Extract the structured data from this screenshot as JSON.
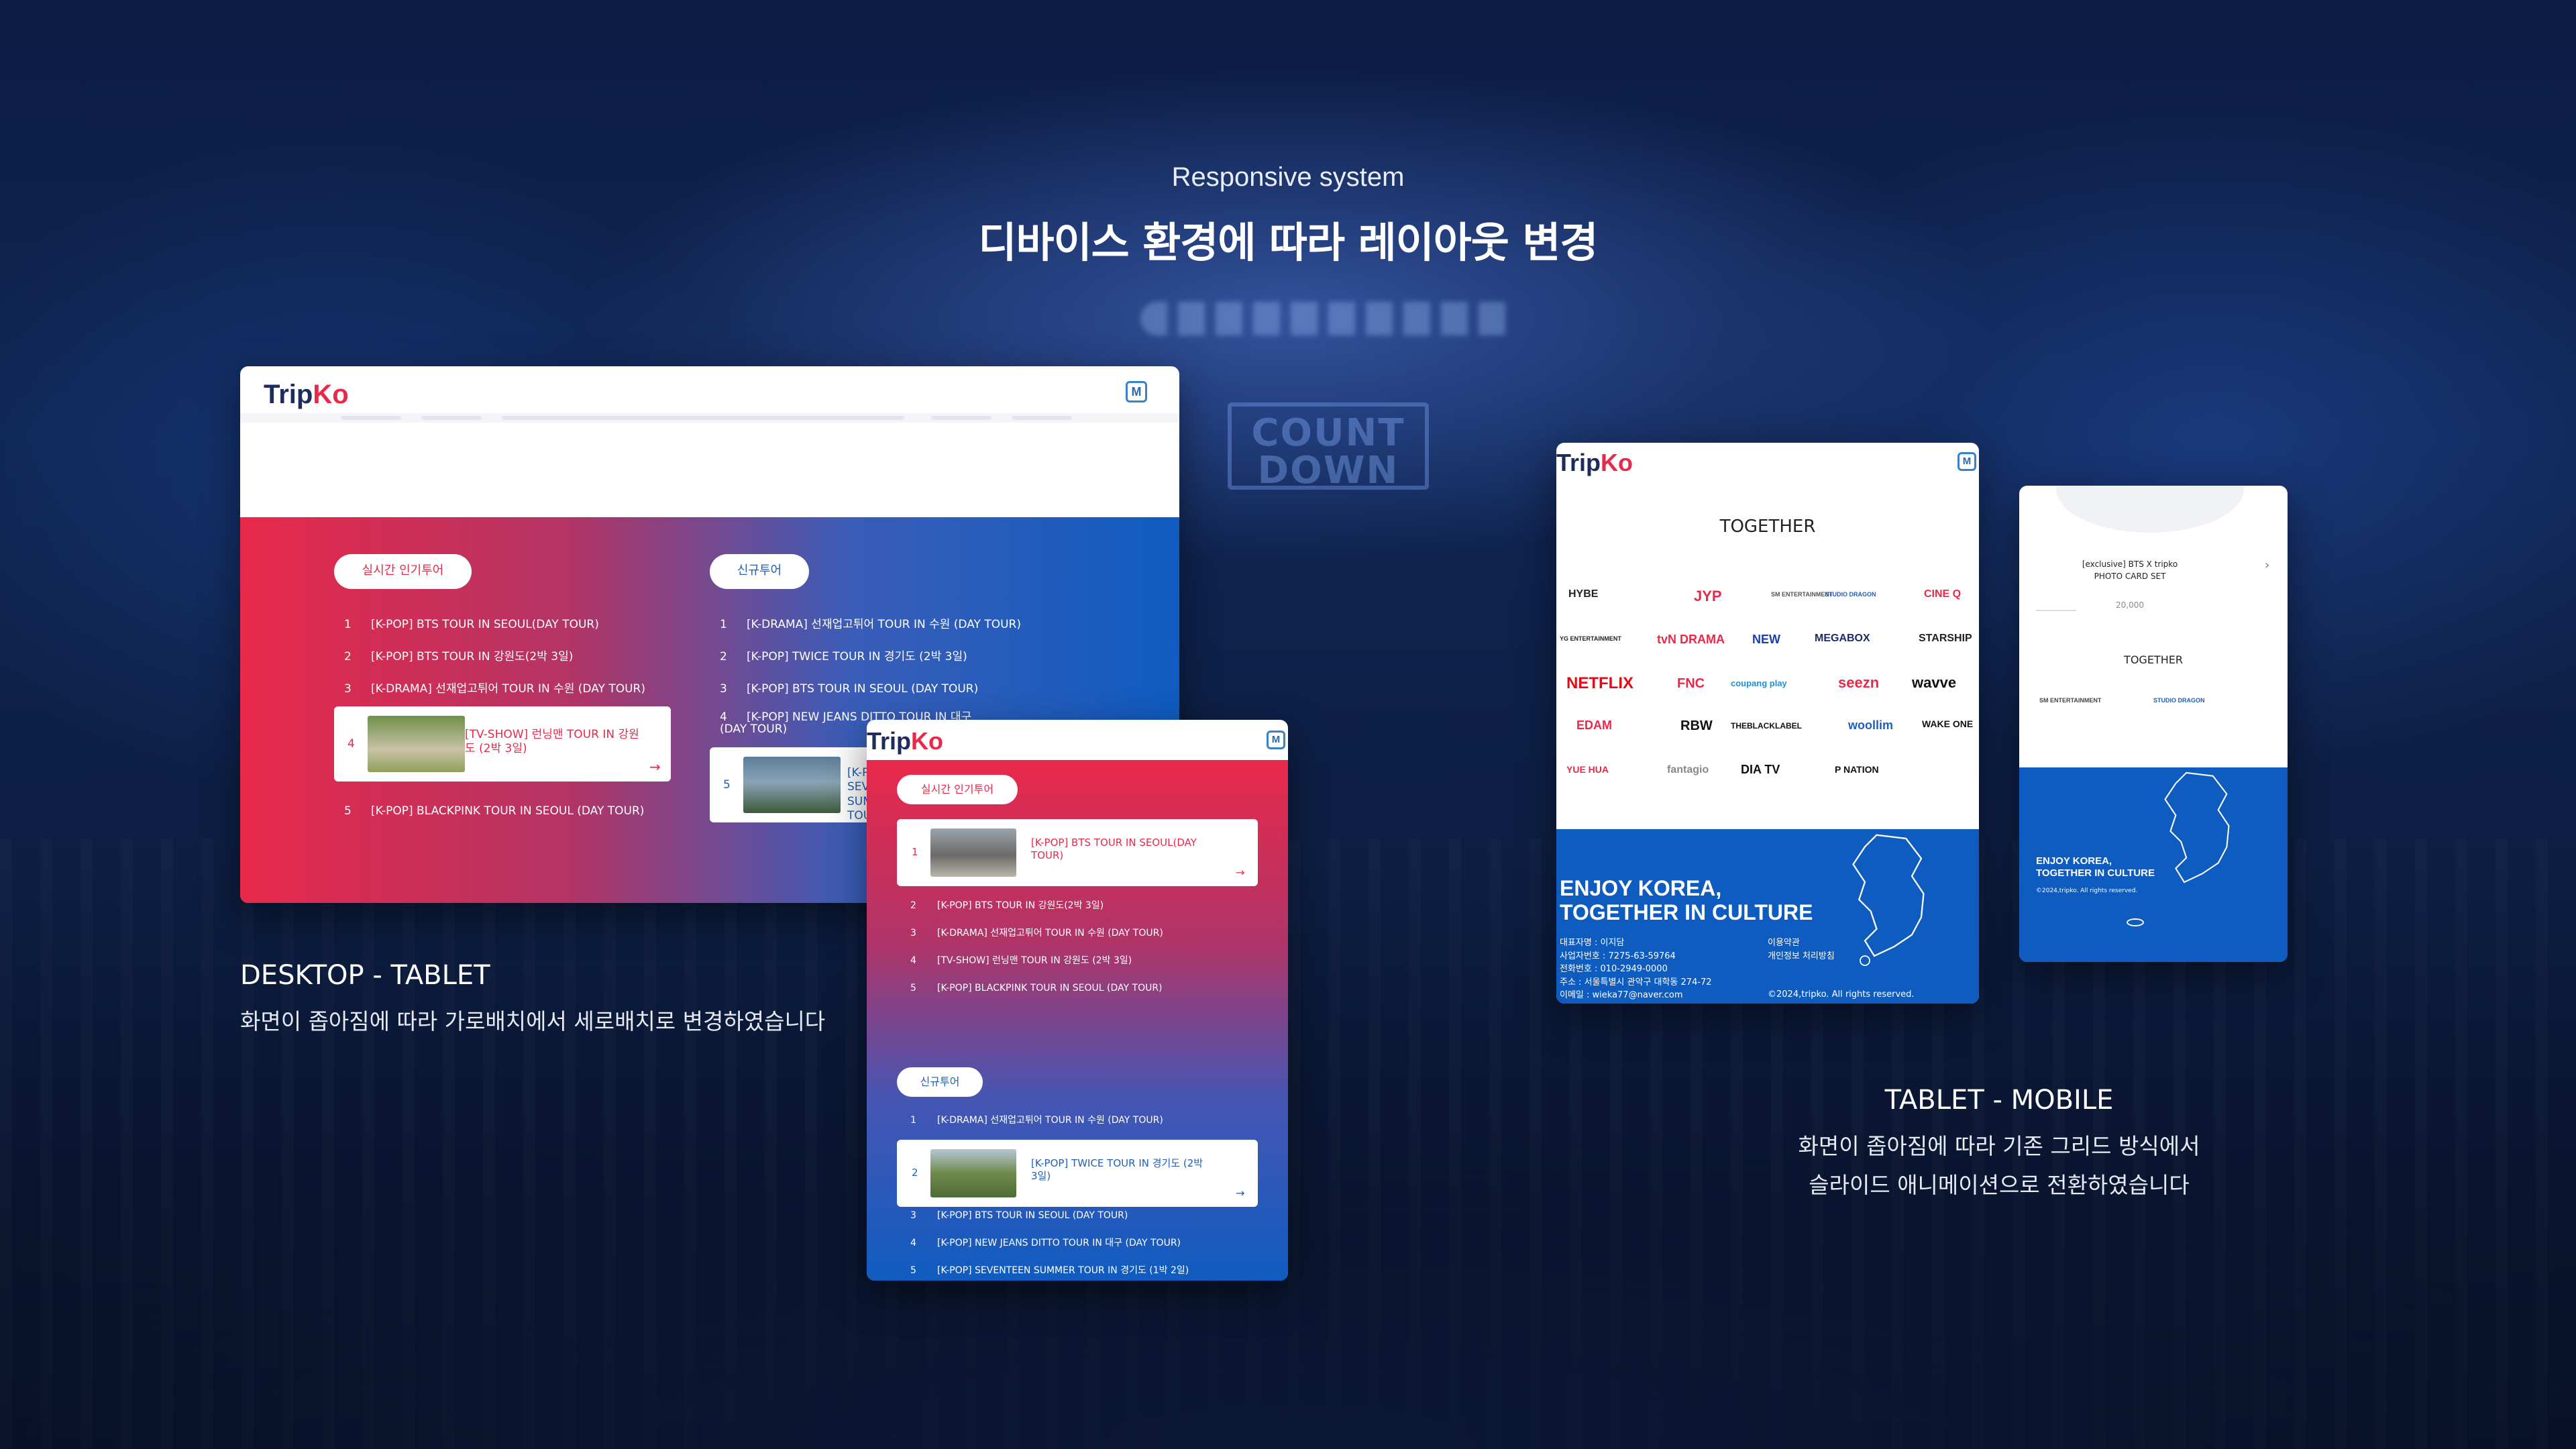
{
  "header": {
    "subtitle": "Responsive system",
    "title": "디바이스 환경에 따라 레이아웃 변경"
  },
  "stage_logo_text": "COUNT DOWN",
  "captions": {
    "left": {
      "title": "DESKTOP - TABLET",
      "desc": "화면이 좁아짐에 따라 가로배치에서 세로배치로 변경하였습니다"
    },
    "right": {
      "title": "TABLET - MOBILE",
      "desc_line1": "화면이 좁아짐에 따라 기존 그리드 방식에서",
      "desc_line2": "슬라이드 애니메이션으로 전환하였습니다"
    }
  },
  "brand": {
    "logo_a": "Trip",
    "logo_b": "Ko",
    "menu_icon": "M"
  },
  "colors": {
    "red": "#e8294a",
    "blue": "#0f5cc0",
    "navy": "#0d1f44"
  },
  "desktop": {
    "popular_label": "실시간 인기투어",
    "new_label": "신규투어",
    "popular": [
      {
        "n": "1",
        "t": "[K-POP] BTS TOUR IN SEOUL(DAY TOUR)"
      },
      {
        "n": "2",
        "t": "[K-POP] BTS TOUR IN 강원도(2박 3일)"
      },
      {
        "n": "3",
        "t": "[K-DRAMA] 선재업고튀어 TOUR IN 수원 (DAY TOUR)"
      },
      {
        "n": "4",
        "t": "[TV-SHOW] 런닝맨 TOUR IN 강원도 (2박 3일)"
      },
      {
        "n": "5",
        "t": "[K-POP] BLACKPINK TOUR IN SEOUL (DAY TOUR)"
      }
    ],
    "new": [
      {
        "n": "1",
        "t": "[K-DRAMA] 선재업고튀어 TOUR IN 수원 (DAY TOUR)"
      },
      {
        "n": "2",
        "t": "[K-POP] TWICE TOUR IN 경기도 (2박 3일)"
      },
      {
        "n": "3",
        "t": "[K-POP] BTS TOUR IN SEOUL (DAY TOUR)"
      },
      {
        "n": "4",
        "t": "[K-POP] NEW JEANS DITTO TOUR IN 대구 (DAY TOUR)"
      },
      {
        "n": "5",
        "t": "[K-POP] SEVENTEEN SUMMER TOUR"
      }
    ]
  },
  "tablet_portrait": {
    "popular_label": "실시간 인기투어",
    "new_label": "신규투어",
    "popular": [
      {
        "n": "1",
        "t": "[K-POP] BTS TOUR IN SEOUL(DAY TOUR)"
      },
      {
        "n": "2",
        "t": "[K-POP] BTS TOUR IN 강원도(2박 3일)"
      },
      {
        "n": "3",
        "t": "[K-DRAMA] 선재업고튀어 TOUR IN 수원 (DAY TOUR)"
      },
      {
        "n": "4",
        "t": "[TV-SHOW] 런닝맨 TOUR IN 강원도 (2박 3일)"
      },
      {
        "n": "5",
        "t": "[K-POP] BLACKPINK TOUR IN SEOUL (DAY TOUR)"
      }
    ],
    "new": [
      {
        "n": "1",
        "t": "[K-DRAMA] 선재업고튀어 TOUR IN 수원 (DAY TOUR)"
      },
      {
        "n": "2",
        "t": "[K-POP] TWICE TOUR IN 경기도 (2박 3일)"
      },
      {
        "n": "3",
        "t": "[K-POP] BTS TOUR IN SEOUL (DAY TOUR)"
      },
      {
        "n": "4",
        "t": "[K-POP] NEW JEANS DITTO TOUR IN 대구 (DAY TOUR)"
      },
      {
        "n": "5",
        "t": "[K-POP] SEVENTEEN SUMMER TOUR IN 경기도 (1박 2일)"
      }
    ]
  },
  "tablet2": {
    "together": "TOGETHER",
    "partners": [
      "HYBE",
      "JYP",
      "SM ENTERTAINMENT",
      "STUDIO DRAGON",
      "CINE Q",
      "YG ENTERTAINMENT",
      "tvN DRAMA",
      "NEW",
      "MEGABOX",
      "STARSHIP",
      "NETFLIX",
      "FNC",
      "coupang play",
      "seezn",
      "wavve",
      "EDAM",
      "RBW",
      "THEBLACKLABEL",
      "woollim",
      "WAKE ONE",
      "YUE HUA",
      "fantagio",
      "DIA TV",
      "P NATION"
    ],
    "footer_title_1": "ENJOY KOREA,",
    "footer_title_2": "TOGETHER IN CULTURE",
    "info": [
      "대표자명 : 이지담",
      "사업자번호 : 7275-63-59764",
      "전화번호 : 010-2949-0000",
      "주소 : 서울특별시 관악구 대학동 274-72",
      "이메일 : wieka77@naver.com"
    ],
    "links": [
      "이용약관",
      "개인정보 처리방침"
    ],
    "copyright": "©2024,tripko. All rights reserved."
  },
  "mobile": {
    "product_title_1": "[exclusive] BTS X tripko",
    "product_title_2": "PHOTO CARD SET",
    "price": "20,000",
    "together": "TOGETHER",
    "partners": [
      "SM ENTERTAINMENT",
      "STUDIO DRAGON"
    ],
    "footer_title_1": "ENJOY KOREA,",
    "footer_title_2": "TOGETHER IN CULTURE",
    "copyright": "©2024,tripko. All rights reserved."
  }
}
